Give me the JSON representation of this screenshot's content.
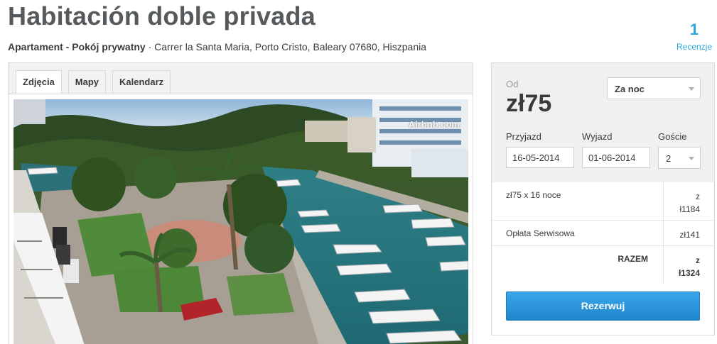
{
  "listing": {
    "title": "Habitación doble privada",
    "property_type": "Apartament - Pokój prywatny",
    "separator": " · ",
    "address": "Carrer la Santa Maria, Porto Cristo, Baleary 07680, Hiszpania"
  },
  "reviews": {
    "count": "1",
    "label": "Recenzje"
  },
  "tabs": [
    {
      "label": "Zdjęcia",
      "active": true
    },
    {
      "label": "Mapy",
      "active": false
    },
    {
      "label": "Kalendarz",
      "active": false
    }
  ],
  "photo": {
    "watermark": "Airbnb.com"
  },
  "booking": {
    "from_label": "Od",
    "price": "zł75",
    "rate_period": "Za noc",
    "checkin_label": "Przyjazd",
    "checkin_value": "16-05-2014",
    "checkout_label": "Wyjazd",
    "checkout_value": "01-06-2014",
    "guests_label": "Goście",
    "guests_value": "2",
    "line_items": [
      {
        "desc": "zł75 x 16 noce",
        "amount_line1": "z",
        "amount_line2": "ł1184"
      },
      {
        "desc": "Opłata Serwisowa",
        "amount": "zł141"
      }
    ],
    "total_label": "RAZEM",
    "total_line1": "z",
    "total_line2": "ł1324",
    "reserve_label": "Rezerwuj"
  },
  "colors": {
    "accent": "#2ea8e0",
    "button": "#2a98e0",
    "title": "#565a5c",
    "panel_bg": "#f0f0f0"
  }
}
